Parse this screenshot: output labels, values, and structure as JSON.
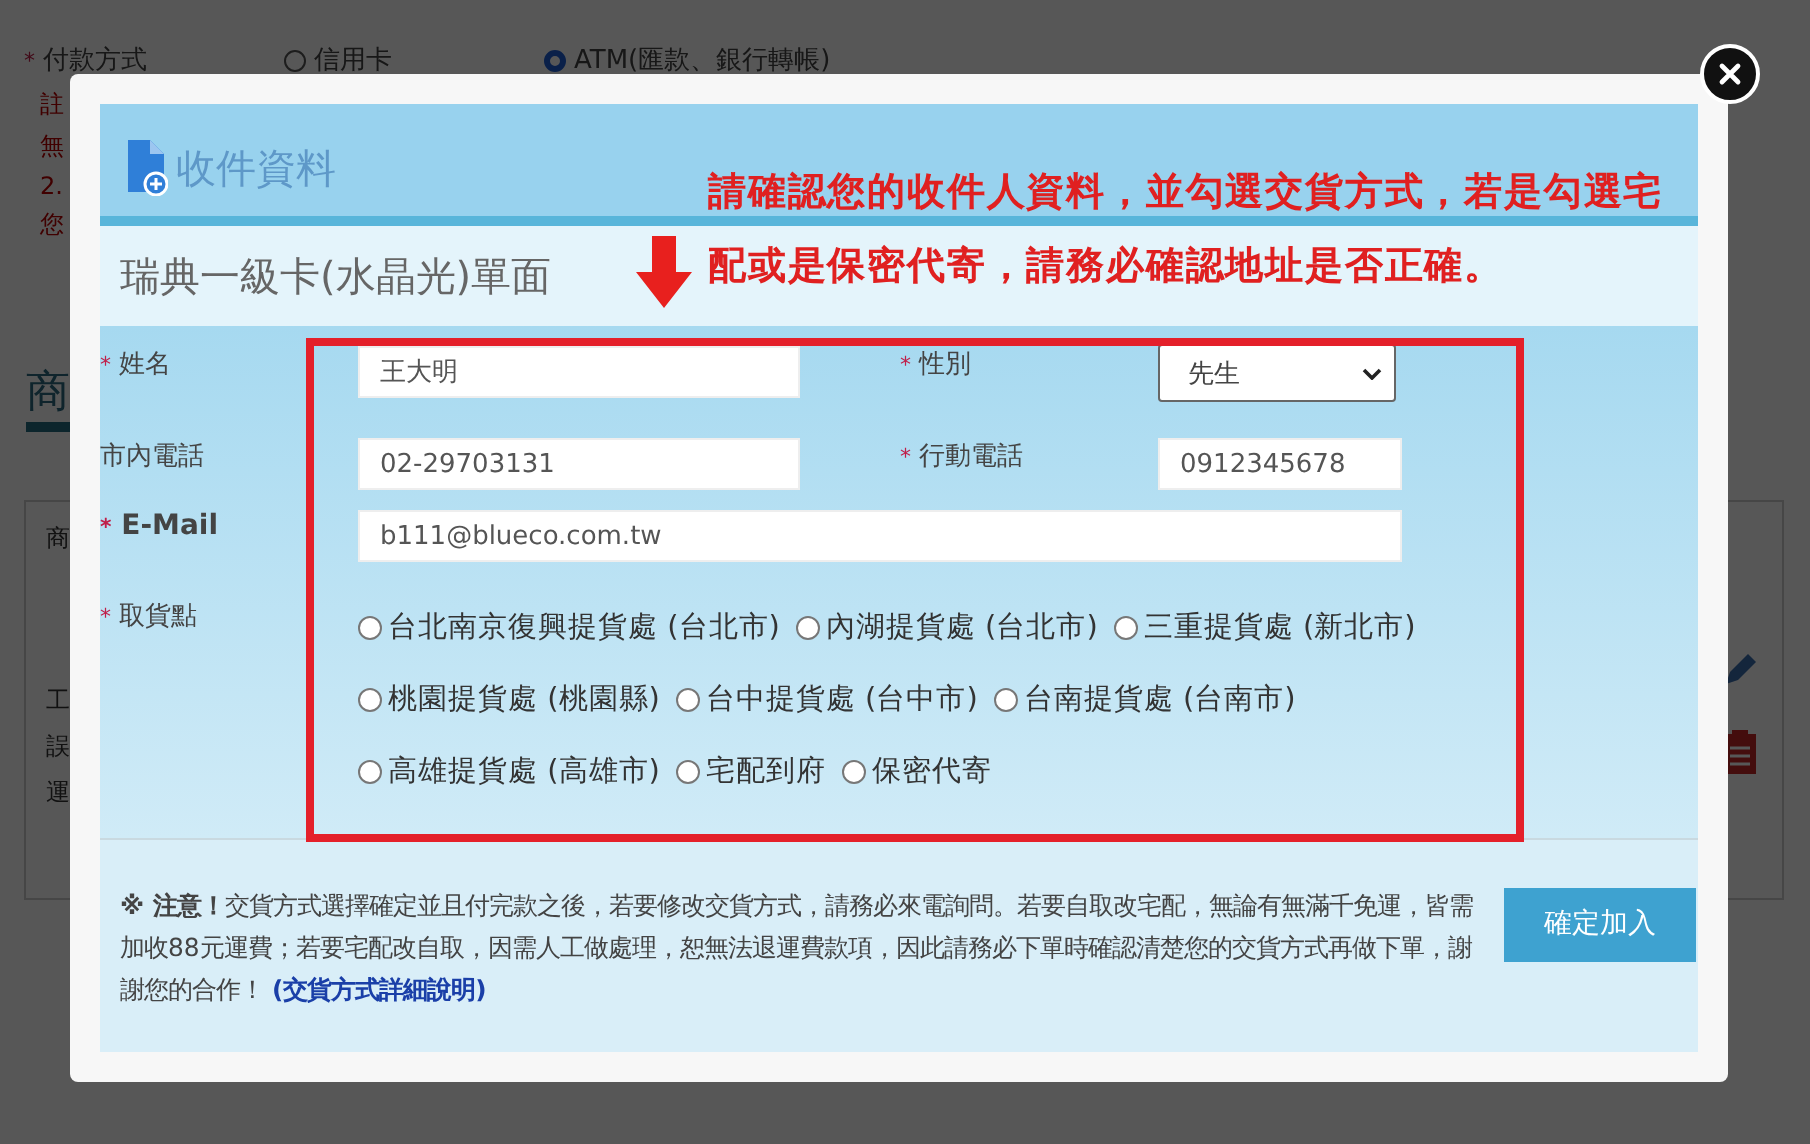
{
  "background": {
    "payment": {
      "marker": "*",
      "label": "付款方式",
      "options": [
        {
          "label": "信用卡",
          "selected": false
        },
        {
          "label": "ATM(匯款、銀行轉帳)",
          "selected": true
        }
      ]
    },
    "note_fragments": [
      "註",
      "無",
      "2.",
      "您"
    ],
    "section_fragment": "商",
    "panel_fragments": [
      {
        "text": "商",
        "kind": "header"
      },
      {
        "text": "工",
        "kind": "plain"
      },
      {
        "text": "誤",
        "kind": "plain"
      },
      {
        "text": "運",
        "kind": "plain"
      }
    ]
  },
  "modal": {
    "title": "收件資料",
    "product_name": "瑞典一級卡(水晶光)單面",
    "notice": "請確認您的收件人資料，並勾選交貨方式，若是勾選宅配或是保密代寄，請務必確認地址是否正確。",
    "fields": {
      "name": {
        "marker": "*",
        "label": "姓名",
        "value": "王大明"
      },
      "gender": {
        "marker": "*",
        "label": "性別",
        "value": "先生"
      },
      "phone": {
        "label": "市內電話",
        "value": "02-29703131"
      },
      "mobile": {
        "marker": "*",
        "label": "行動電話",
        "value": "0912345678"
      },
      "email": {
        "marker": "*",
        "label": "E-Mail",
        "value": "b111@blueco.com.tw"
      },
      "pickup": {
        "marker": "*",
        "label": "取貨點",
        "options": [
          {
            "label": "台北南京復興提貨處 (台北市)",
            "selected": false
          },
          {
            "label": "內湖提貨處 (台北市)",
            "selected": false
          },
          {
            "label": "三重提貨處 (新北市)",
            "selected": false
          },
          {
            "label": "桃園提貨處 (桃園縣)",
            "selected": false
          },
          {
            "label": "台中提貨處 (台中市)",
            "selected": false
          },
          {
            "label": "台南提貨處 (台南市)",
            "selected": false
          },
          {
            "label": "高雄提貨處 (高雄市)",
            "selected": false
          },
          {
            "label": "宅配到府",
            "selected": false
          },
          {
            "label": "保密代寄",
            "selected": false
          }
        ]
      }
    },
    "note": {
      "text": "**※ 注意！**交貨方式選擇確定並且付完款之後，若要修改交貨方式，請務必來電詢問。若要自取改宅配，無論有無滿千免運，皆需加收88元運費；若要宅配改自取，因需人工做處理，恕無法退運費款項，因此請務必下單時確認清楚您的交貨方式再做下單，謝謝您的合作！ ",
      "link": "(交貨方式詳細說明)"
    },
    "confirm_button": "確定加入"
  }
}
